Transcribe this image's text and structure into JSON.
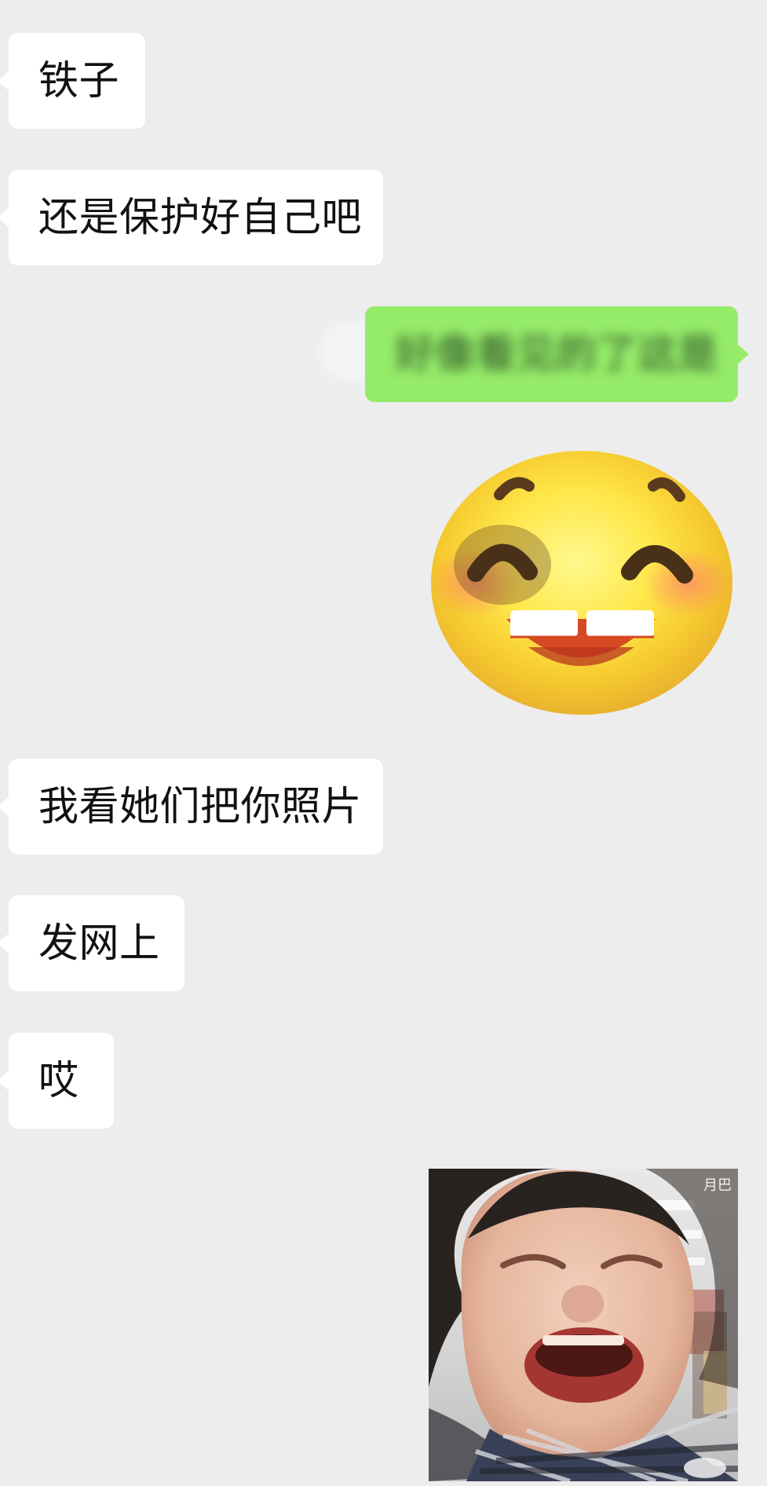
{
  "messages": {
    "m1": "铁子",
    "m2": "还是保护好自己吧",
    "m3_blurred": "好像看见的了这是",
    "m4": "我看她们把你照片",
    "m5": "发网上",
    "m6": "哎"
  },
  "stickers": {
    "smile": "smiling-emoji-sticker",
    "crying": "crying-child-sticker"
  },
  "watermark": "月巴",
  "colors": {
    "background": "#ededed",
    "incoming_bubble": "#ffffff",
    "outgoing_bubble": "#95ec69"
  }
}
